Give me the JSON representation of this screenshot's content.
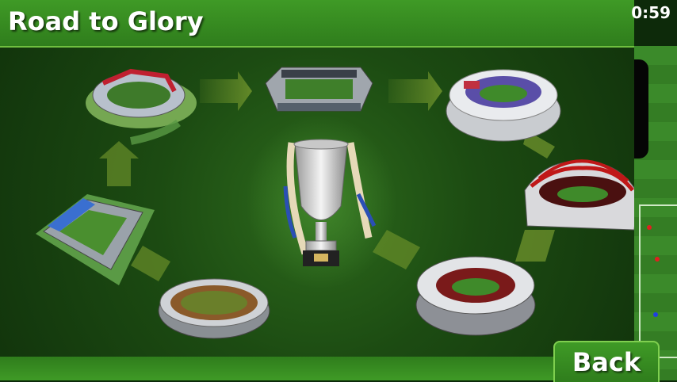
{
  "header": {
    "title": "Road to Glory"
  },
  "status": {
    "time": "0:59"
  },
  "footer": {
    "back_label": "Back"
  },
  "colors": {
    "header_green": "#3f9a26",
    "board_green": "#1c4b12",
    "arrow_green": "#6a8f2a",
    "trophy_silver": "#d8d8d8",
    "ribbon_blue": "#2a4fb5"
  },
  "map": {
    "stadiums": [
      {
        "icon": "stadium-1-icon",
        "status": "unlocked"
      },
      {
        "icon": "stadium-2-icon",
        "status": "unlocked"
      },
      {
        "icon": "stadium-3-icon",
        "status": "unlocked"
      },
      {
        "icon": "stadium-4-icon",
        "status": "unlocked"
      },
      {
        "icon": "stadium-5-icon",
        "status": "unlocked"
      },
      {
        "icon": "stadium-6-icon",
        "status": "unlocked"
      },
      {
        "icon": "stadium-7-icon",
        "status": "unlocked"
      }
    ],
    "center_icon": "trophy-icon"
  }
}
